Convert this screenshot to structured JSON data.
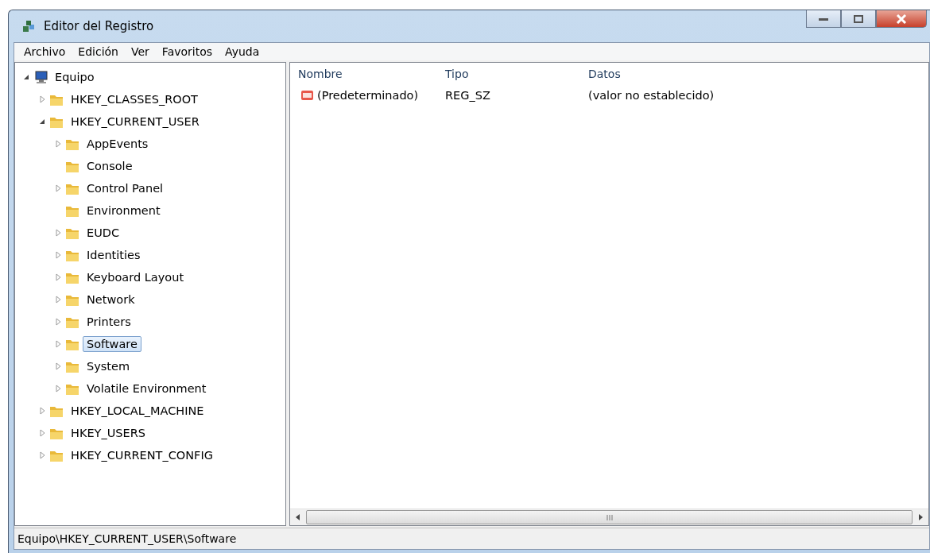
{
  "window": {
    "title": "Editor del Registro"
  },
  "menu": [
    "Archivo",
    "Edición",
    "Ver",
    "Favoritos",
    "Ayuda"
  ],
  "tree": [
    {
      "label": "Equipo",
      "kind": "computer",
      "expanded": true,
      "selected": false,
      "children": [
        {
          "label": "HKEY_CLASSES_ROOT",
          "kind": "folder",
          "expanded": false,
          "selected": false
        },
        {
          "label": "HKEY_CURRENT_USER",
          "kind": "folder",
          "expanded": true,
          "selected": false,
          "children": [
            {
              "label": "AppEvents",
              "kind": "folder",
              "expanded": false,
              "selected": false
            },
            {
              "label": "Console",
              "kind": "folder",
              "selected": false
            },
            {
              "label": "Control Panel",
              "kind": "folder",
              "expanded": false,
              "selected": false
            },
            {
              "label": "Environment",
              "kind": "folder",
              "selected": false
            },
            {
              "label": "EUDC",
              "kind": "folder",
              "expanded": false,
              "selected": false
            },
            {
              "label": "Identities",
              "kind": "folder",
              "expanded": false,
              "selected": false
            },
            {
              "label": "Keyboard Layout",
              "kind": "folder",
              "expanded": false,
              "selected": false
            },
            {
              "label": "Network",
              "kind": "folder",
              "expanded": false,
              "selected": false
            },
            {
              "label": "Printers",
              "kind": "folder",
              "expanded": false,
              "selected": false
            },
            {
              "label": "Software",
              "kind": "folder",
              "expanded": false,
              "selected": true
            },
            {
              "label": "System",
              "kind": "folder",
              "expanded": false,
              "selected": false
            },
            {
              "label": "Volatile Environment",
              "kind": "folder",
              "expanded": false,
              "selected": false
            }
          ]
        },
        {
          "label": "HKEY_LOCAL_MACHINE",
          "kind": "folder",
          "expanded": false,
          "selected": false
        },
        {
          "label": "HKEY_USERS",
          "kind": "folder",
          "expanded": false,
          "selected": false
        },
        {
          "label": "HKEY_CURRENT_CONFIG",
          "kind": "folder",
          "expanded": false,
          "selected": false
        }
      ]
    }
  ],
  "table": {
    "columns": [
      "Nombre",
      "Tipo",
      "Datos"
    ],
    "rows": [
      {
        "name": "(Predeterminado)",
        "type": "REG_SZ",
        "data": "(valor no establecido)"
      }
    ]
  },
  "status_bar": "Equipo\\HKEY_CURRENT_USER\\Software"
}
